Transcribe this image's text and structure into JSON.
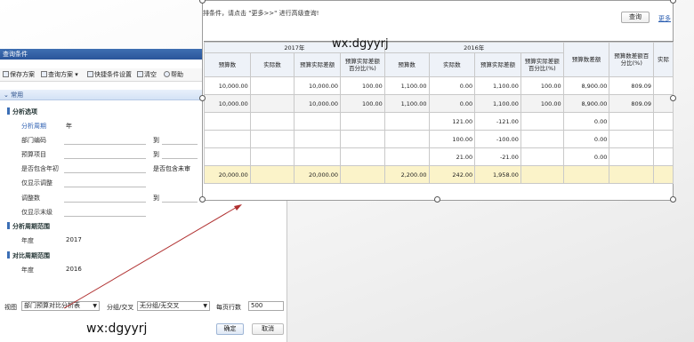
{
  "dialog": {
    "title": "查询条件",
    "toolbar": {
      "save_scheme": "保存方案",
      "query_scheme": "查询方案",
      "quick_settings": "快捷条件设置",
      "clear": "清空",
      "help": "帮助"
    },
    "section": "常用",
    "groups": {
      "analysis_options": "分析选项",
      "analysis_period": "分析周期范围",
      "compare_period": "对比周期范围"
    },
    "fields": {
      "cycle_label": "分析周期",
      "cycle_value": "年",
      "dept_label": "部门编码",
      "to1": "到",
      "budget_item_label": "预算项目",
      "to2": "到",
      "include_begin_label": "是否包含年初",
      "include_end_label": "是否包含未审",
      "adjust_only_label": "仅显示调整",
      "adjust_label": "调整数",
      "to3": "到",
      "leaf_only_label": "仅显示末级",
      "year_label": "年度",
      "year_value": "2017",
      "cmp_year_label": "年度",
      "cmp_year_value": "2016"
    },
    "bottom": {
      "view_label": "视图",
      "view_value": "部门预算对比分析表",
      "group_label": "分组/交叉",
      "group_value": "无分组/无交叉",
      "rows_label": "每页行数",
      "rows_value": "500",
      "ok": "确定",
      "cancel": "取消"
    }
  },
  "panel": {
    "hint": "排条件，请点击 \"更多>>\" 进行高级查询!",
    "query_button": "查询",
    "more_link": "更多",
    "columns_2017": "2017年",
    "columns_2016": "2016年",
    "headers": [
      "预算数",
      "实际数",
      "预算实际差额",
      "预算实际差额百分比(%)",
      "预算数",
      "实际数",
      "预算实际差额",
      "预算实际差额百分比(%)",
      "预算数差额",
      "预算数差额百分比(%)",
      "实际"
    ],
    "rows": [
      [
        "10,000.00",
        "",
        "10,000.00",
        "100.00",
        "1,100.00",
        "0.00",
        "1,100.00",
        "100.00",
        "8,900.00",
        "809.09",
        ""
      ],
      [
        "10,000.00",
        "",
        "10,000.00",
        "100.00",
        "1,100.00",
        "0.00",
        "1,100.00",
        "100.00",
        "8,900.00",
        "809.09",
        ""
      ],
      [
        "",
        "",
        "",
        "",
        "",
        "121.00",
        "-121.00",
        "",
        "0.00",
        "",
        ""
      ],
      [
        "",
        "",
        "",
        "",
        "",
        "100.00",
        "-100.00",
        "",
        "0.00",
        "",
        ""
      ],
      [
        "",
        "",
        "",
        "",
        "",
        "21.00",
        "-21.00",
        "",
        "0.00",
        "",
        ""
      ],
      [
        "20,000.00",
        "",
        "20,000.00",
        "",
        "2,200.00",
        "242.00",
        "1,958.00",
        "",
        "",
        "",
        ""
      ]
    ]
  },
  "watermarks": {
    "top": "wx:dgyyrj",
    "bottom": "wx:dgyyrj"
  },
  "colors": {
    "title_bar": "#2f5fa5",
    "total_row": "#fbf3c9",
    "annotation_line": "#b03030"
  }
}
